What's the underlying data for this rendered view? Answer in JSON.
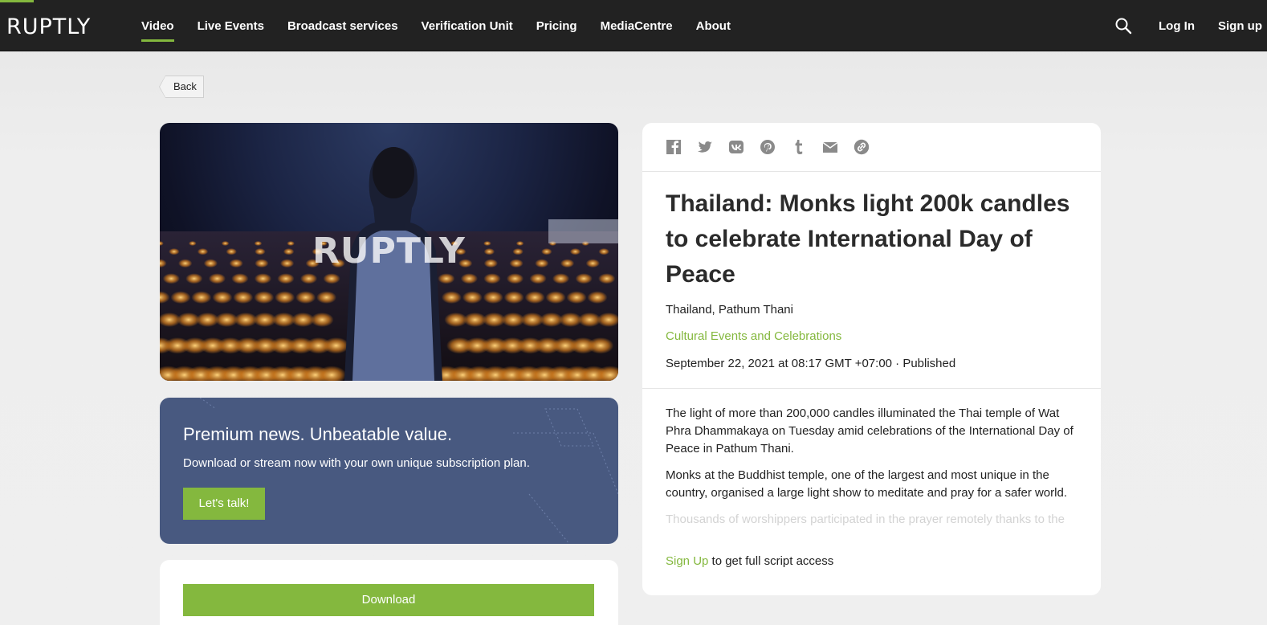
{
  "brand": {
    "logo_text": "RUPTLY",
    "accent": "#84b83e",
    "nav_bg": "#222222"
  },
  "nav": {
    "items": [
      {
        "label": "Video",
        "active": true
      },
      {
        "label": "Live Events"
      },
      {
        "label": "Broadcast services"
      },
      {
        "label": "Verification Unit"
      },
      {
        "label": "Pricing"
      },
      {
        "label": "MediaCentre"
      },
      {
        "label": "About"
      }
    ],
    "search_icon": "search-icon",
    "login_label": "Log In",
    "signup_label": "Sign up"
  },
  "back_label": "Back",
  "video": {
    "watermark": "RUPTLY"
  },
  "promo": {
    "heading": "Premium news. Unbeatable value.",
    "subtext": "Download or stream now with your own unique subscription plan.",
    "cta_label": "Let's talk!",
    "bg_color": "#485980"
  },
  "download_label": "Download",
  "share_icons": [
    "facebook-icon",
    "twitter-icon",
    "vk-icon",
    "pinterest-icon",
    "tumblr-icon",
    "email-icon",
    "link-icon"
  ],
  "article": {
    "title": "Thailand: Monks light 200k candles to celebrate International Day of Peace",
    "location": "Thailand, Pathum Thani",
    "category": "Cultural Events and Celebrations",
    "date": "September 22, 2021 at 08:17 GMT +07:00 · Published",
    "paragraphs": [
      "The light of more than 200,000 candles illuminated the Thai temple of Wat Phra Dhammakaya on Tuesday amid celebrations of the International Day of Peace in Pathum Thani.",
      "Monks at the Buddhist temple, one of the largest and most unique in the country, organised a large light show to meditate and pray for a safer world.",
      "Thousands of worshippers participated in the prayer remotely thanks to the"
    ],
    "signup_link": "Sign Up",
    "signup_rest": " to get full script access"
  }
}
